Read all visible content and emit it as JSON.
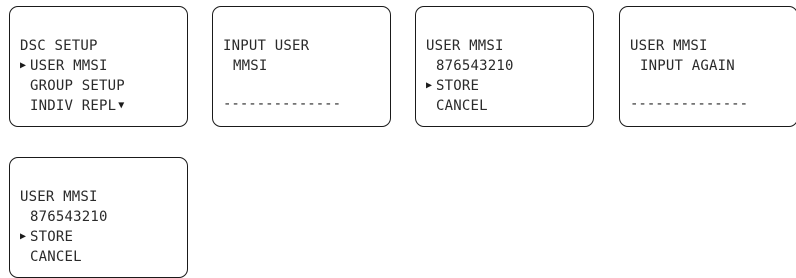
{
  "screens": [
    {
      "lines": [
        {
          "cursor": "",
          "text": "DSC SETUP",
          "more": ""
        },
        {
          "cursor": "▶",
          "text": "USER MMSI",
          "more": ""
        },
        {
          "cursor": " ",
          "text": "GROUP SETUP",
          "more": ""
        },
        {
          "cursor": " ",
          "text": "INDIV REPL",
          "more": "▼"
        }
      ],
      "entry": ""
    },
    {
      "lines": [
        {
          "cursor": "",
          "text": "INPUT USER",
          "more": ""
        },
        {
          "cursor": " ",
          "text": "MMSI",
          "more": ""
        }
      ],
      "entry": "--------------"
    },
    {
      "lines": [
        {
          "cursor": "",
          "text": "USER MMSI",
          "more": ""
        },
        {
          "cursor": " ",
          "text": "876543210",
          "more": ""
        },
        {
          "cursor": "▶",
          "text": "STORE",
          "more": ""
        },
        {
          "cursor": " ",
          "text": "CANCEL",
          "more": ""
        }
      ],
      "entry": ""
    },
    {
      "lines": [
        {
          "cursor": "",
          "text": "USER MMSI",
          "more": ""
        },
        {
          "cursor": " ",
          "text": "INPUT AGAIN",
          "more": ""
        }
      ],
      "entry": "--------------"
    },
    {
      "lines": [
        {
          "cursor": "",
          "text": "USER MMSI",
          "more": ""
        },
        {
          "cursor": " ",
          "text": "876543210",
          "more": ""
        },
        {
          "cursor": "▶",
          "text": "STORE",
          "more": ""
        },
        {
          "cursor": " ",
          "text": "CANCEL",
          "more": ""
        }
      ],
      "entry": ""
    }
  ]
}
